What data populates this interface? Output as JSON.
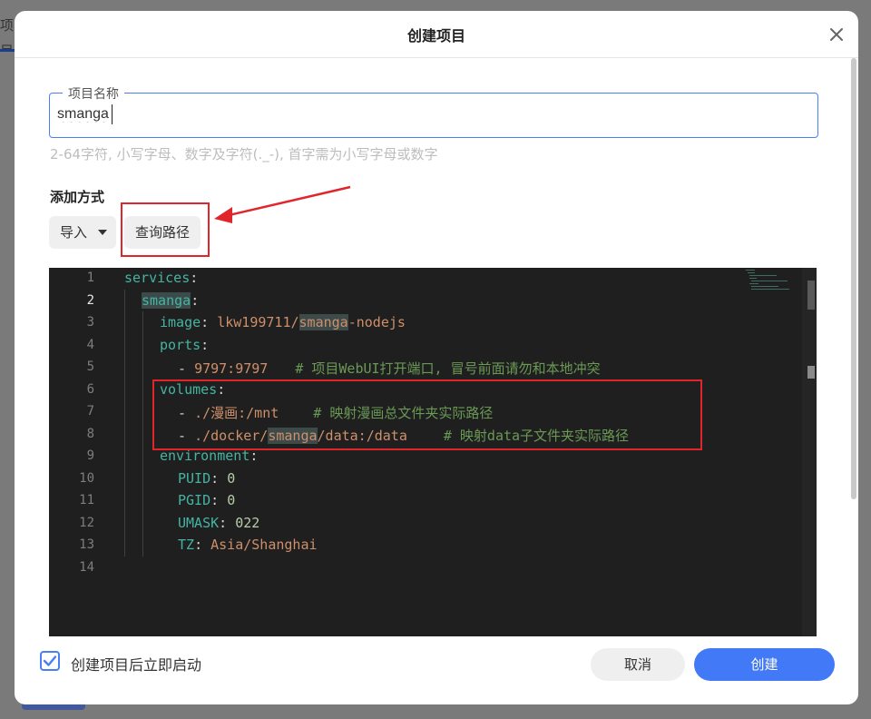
{
  "background": {
    "tab_label": "项目"
  },
  "dialog": {
    "title": "创建项目",
    "name_field": {
      "legend": "项目名称",
      "value": "smanga"
    },
    "hint": "2-64字符, 小写字母、数字及字符(._-), 首字需为小写字母或数字",
    "add_method_label": "添加方式",
    "import_dropdown": {
      "selected": "导入"
    },
    "query_path_button": "查询路径",
    "editor": {
      "line_numbers": [
        "1",
        "2",
        "3",
        "4",
        "5",
        "6",
        "7",
        "8",
        "9",
        "10",
        "11",
        "12",
        "13",
        "14"
      ],
      "current_line": 2
    },
    "autostart": {
      "label": "创建项目后立即启动",
      "checked": true
    },
    "cancel_button": "取消",
    "create_button": "创建"
  },
  "colors": {
    "accent": "#4279f6",
    "highlight_box": "#e0262b",
    "editor_bg": "#1f1f1f"
  },
  "code": {
    "l1": {
      "key": "services",
      "colon": ":"
    },
    "l2": {
      "key": "smanga",
      "colon": ":"
    },
    "l3": {
      "key": "image",
      "colon": ": ",
      "val_a": "lkw199711/",
      "val_b": "smanga",
      "val_c": "-nodejs"
    },
    "l4": {
      "key": "ports",
      "colon": ":"
    },
    "l5": {
      "dash": "- ",
      "val": "9797:9797",
      "comment": "# 项目WebUI打开端口, 冒号前面请勿和本地冲突"
    },
    "l6": {
      "key": "volumes",
      "colon": ":"
    },
    "l7": {
      "dash": "- ",
      "val": "./漫画:/mnt",
      "comment": "# 映射漫画总文件夹实际路径"
    },
    "l8": {
      "dash": "- ",
      "val_a": "./docker/",
      "val_b": "smanga",
      "val_c": "/data:/data",
      "comment": "# 映射data子文件夹实际路径"
    },
    "l9": {
      "key": "environment",
      "colon": ":"
    },
    "l10": {
      "key": "PUID",
      "colon": ": ",
      "val": "0"
    },
    "l11": {
      "key": "PGID",
      "colon": ": ",
      "val": "0"
    },
    "l12": {
      "key": "UMASK",
      "colon": ": ",
      "val": "022"
    },
    "l13": {
      "key": "TZ",
      "colon": ": ",
      "val": "Asia/Shanghai"
    }
  }
}
